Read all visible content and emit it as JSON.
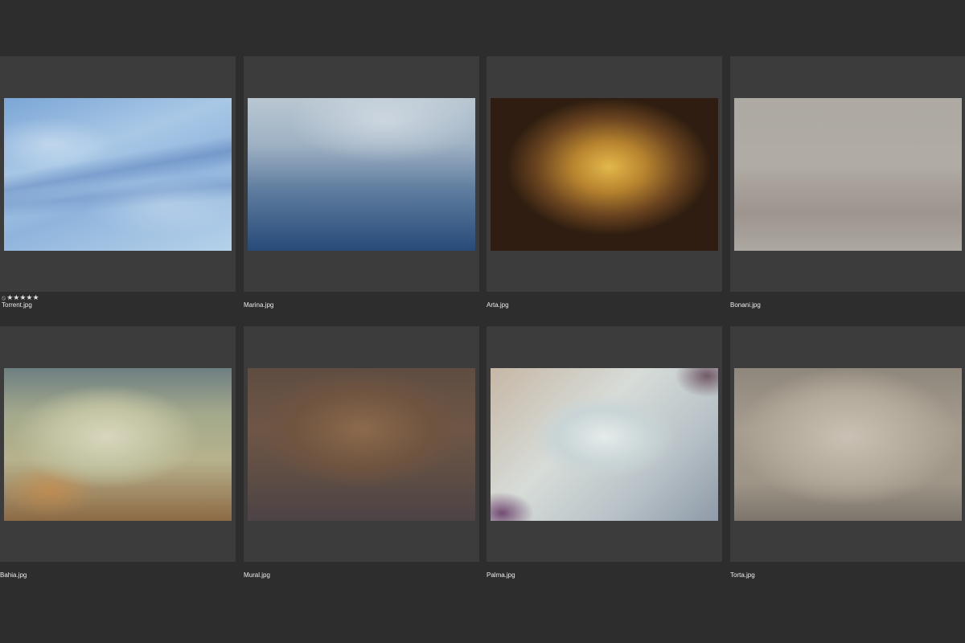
{
  "grid": {
    "items": [
      {
        "filename": "Torrent.jpg",
        "rating_stars": "★★★★★",
        "reject_icon": "⦸",
        "rating": 5,
        "selected": false,
        "colors": [
          "#7ba6d6",
          "#b6d2ea"
        ]
      },
      {
        "filename": "Marina.jpg",
        "colors": [
          "#b9c7d2",
          "#274a78"
        ]
      },
      {
        "filename": "Arta.jpg",
        "colors": [
          "#e3b84c",
          "#2e1d10"
        ]
      },
      {
        "filename": "Bonani.jpg",
        "colors": [
          "#a9a59e",
          "#ada8a1"
        ]
      },
      {
        "filename": "Bahia.jpg",
        "colors": [
          "#c3c4a3",
          "#8c6a45"
        ]
      },
      {
        "filename": "Mural.jpg",
        "colors": [
          "#8c6a4c",
          "#4d4346"
        ]
      },
      {
        "filename": "Palma.jpg",
        "colors": [
          "#e4ebea",
          "#8e9aa8"
        ]
      },
      {
        "filename": "Torta.jpg",
        "colors": [
          "#c9c1b3",
          "#7d756c"
        ]
      }
    ]
  },
  "colors": {
    "background": "#2d2d2d",
    "cell_background": "#3c3c3c",
    "caption_text": "#ececec"
  }
}
